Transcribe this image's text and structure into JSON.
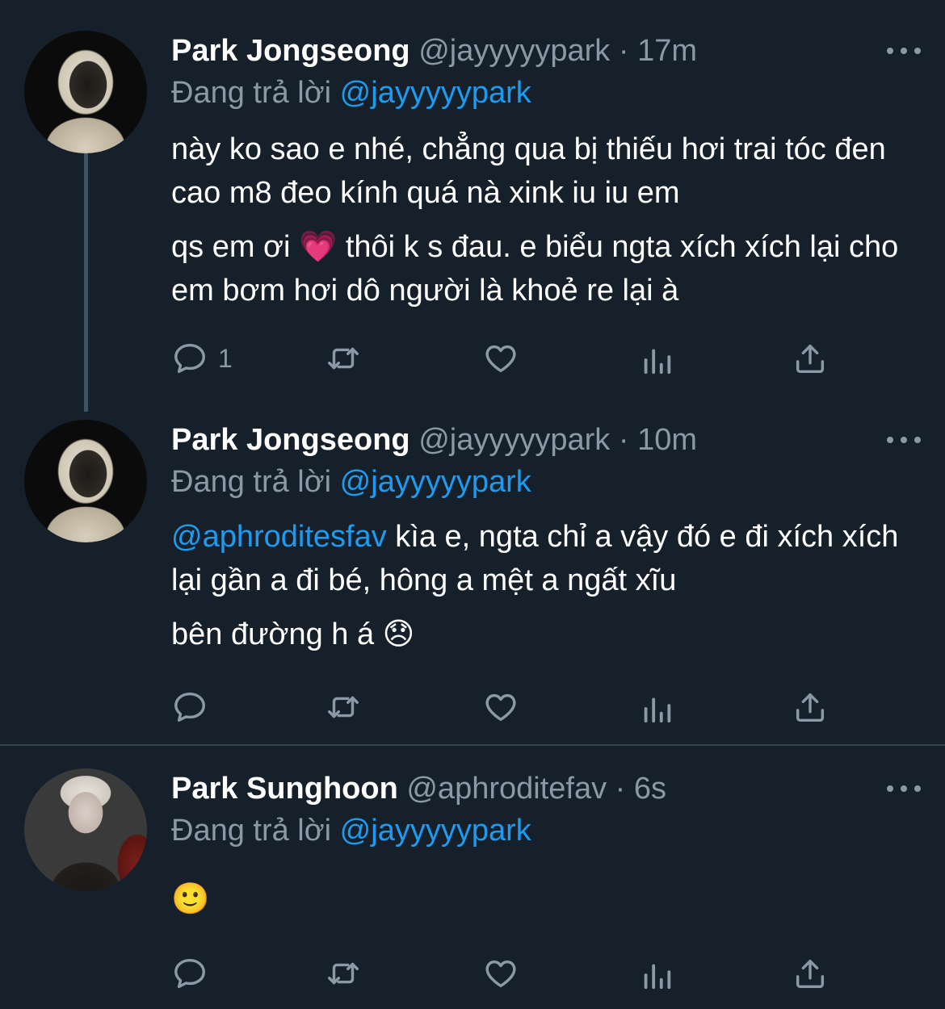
{
  "thread": {
    "tweets": [
      {
        "name": "Park Jongseong",
        "handle": "@jayyyyypark",
        "dot": "·",
        "time": "17m",
        "replying_prefix": "Đang trả lời",
        "replying_to": "@jayyyyypark",
        "paragraph1": "này ko sao e nhé, chẳng qua bị thiếu hơi trai tóc đen cao m8 đeo kính quá nà xink iu iu em",
        "paragraph2_text": "qs em ơi",
        "paragraph2_emoji": "💗",
        "paragraph2_rest": "thôi k s đau. e biểu ngta xích xích lại cho em bơm hơi dô người là khoẻ re lại à",
        "reply_count": "1"
      },
      {
        "name": "Park Jongseong",
        "handle": "@jayyyyypark",
        "dot": "·",
        "time": "10m",
        "replying_prefix": "Đang trả lời",
        "replying_to": "@jayyyyypark",
        "mention": "@aphroditesfav",
        "paragraph1": "kìa e, ngta chỉ a vậy đó e đi xích xích lại gần a đi bé, hông a mệt a ngất xĩu",
        "paragraph2_text": "bên đường h á",
        "paragraph2_emoji": "😞"
      },
      {
        "name": "Park Sunghoon",
        "handle": "@aphroditefav",
        "dot": "·",
        "time": "6s",
        "replying_prefix": "Đang trả lời",
        "replying_to": "@jayyyyypark",
        "emoji": "🙂"
      }
    ]
  },
  "icons": {
    "reply": "reply-icon",
    "retweet": "retweet-icon",
    "like": "like-icon",
    "analytics": "analytics-icon",
    "share": "share-icon",
    "more": "more-icon"
  },
  "colors": {
    "background": "#15202b",
    "link": "#1d9bf0",
    "secondary": "#8b98a5",
    "thread_line": "#3d5466",
    "divider": "#38444d"
  }
}
